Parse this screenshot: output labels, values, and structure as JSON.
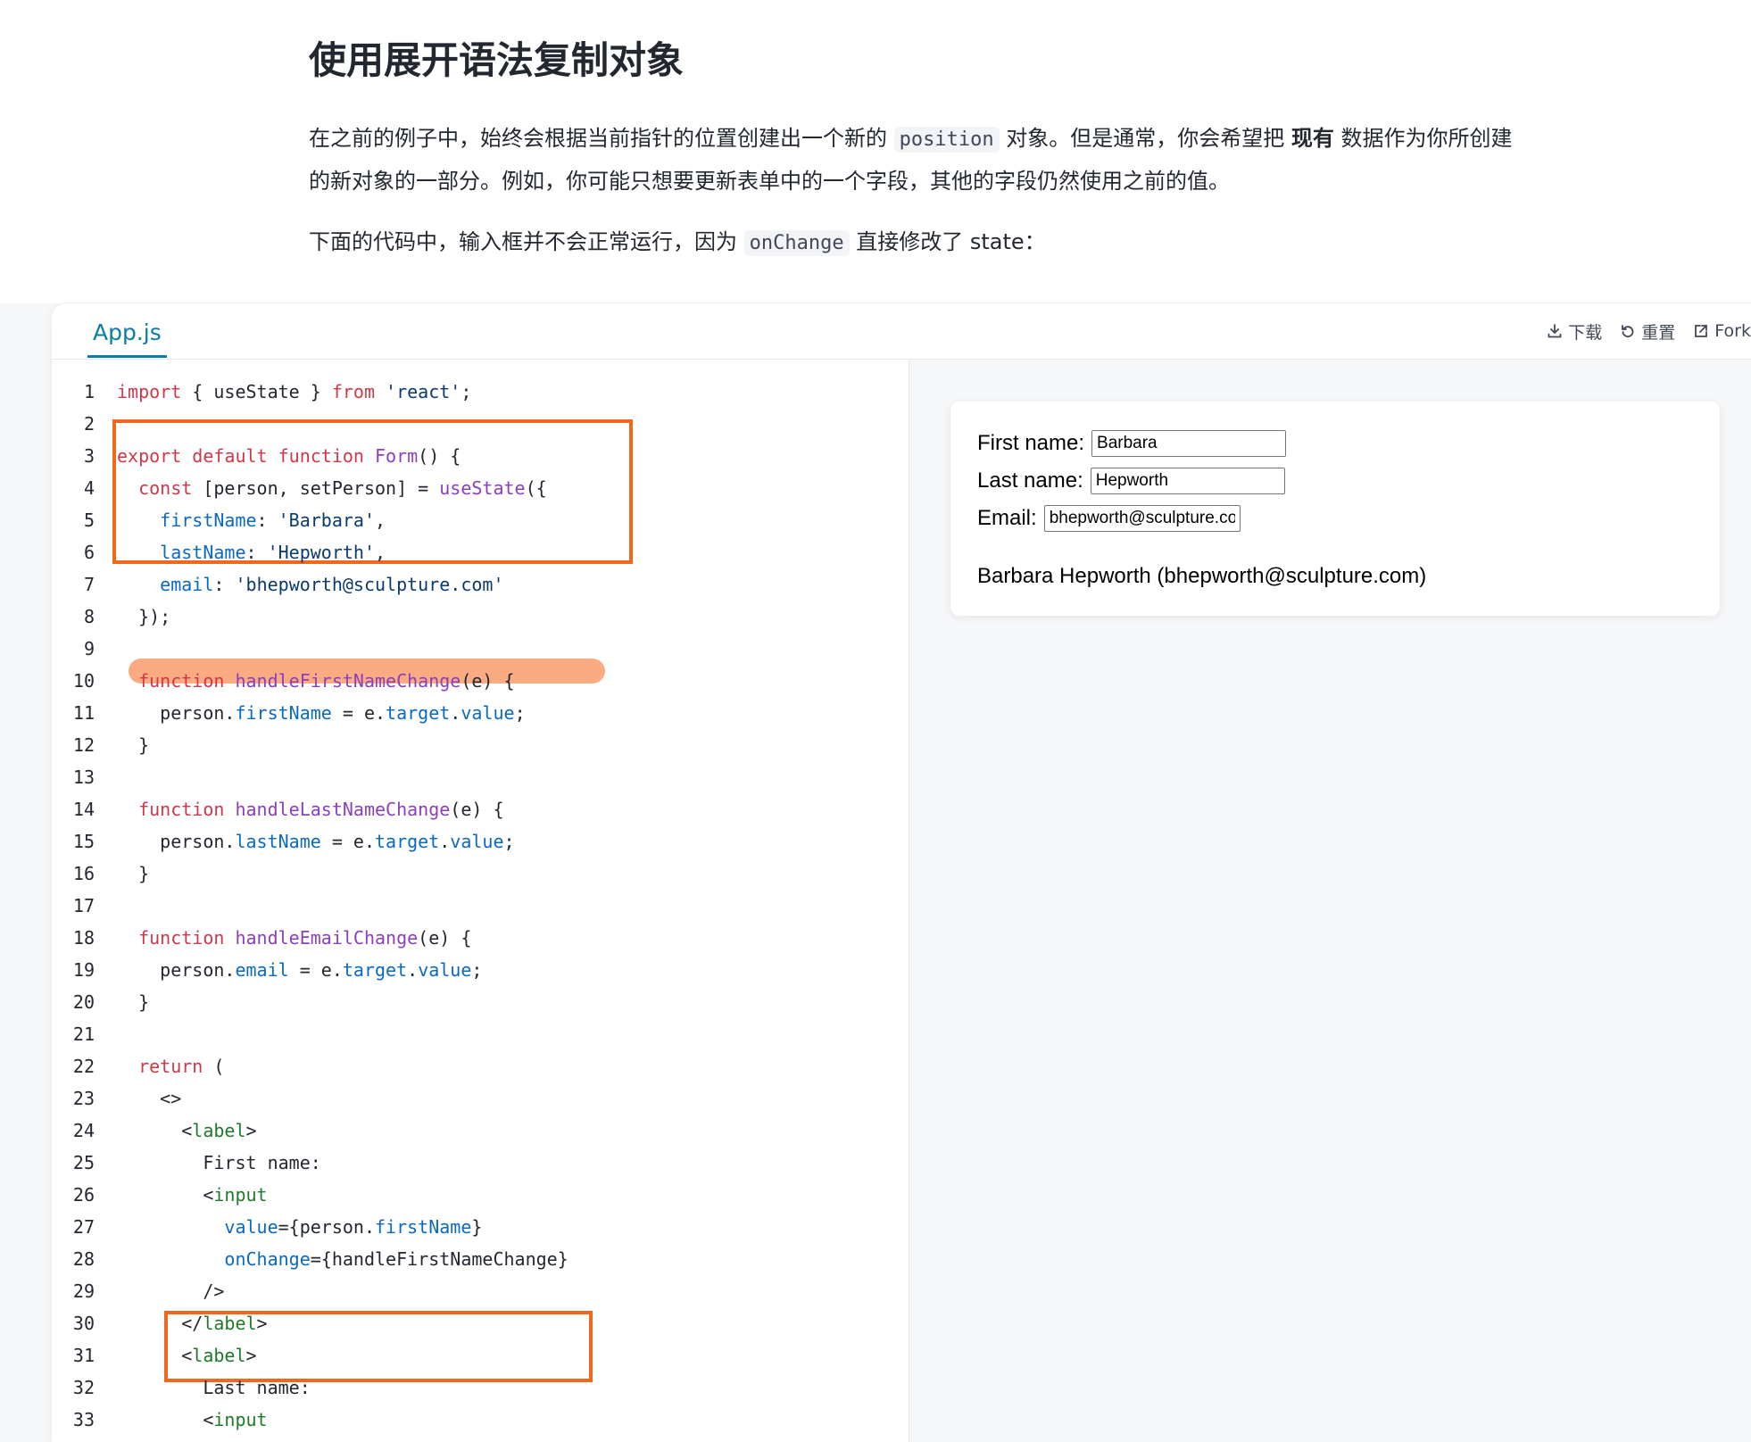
{
  "article": {
    "heading": "使用展开语法复制对象",
    "p1_a": "在之前的例子中，始终会根据当前指针的位置创建出一个新的 ",
    "p1_code": "position",
    "p1_b": " 对象。但是通常，你会希望把 ",
    "p1_bold": "现有",
    "p1_c": " 数据作为你所创建的新对象的一部分。例如，你可能只想要更新表单中的一个字段，其他的字段仍然使用之前的值。",
    "p2_a": "下面的代码中，输入框并不会正常运行，因为 ",
    "p2_code": "onChange",
    "p2_b": " 直接修改了 state："
  },
  "sandbox": {
    "file_tab": "App.js",
    "download_label": "下载",
    "reset_label": "重置",
    "fork_label": "Fork"
  },
  "preview": {
    "first_label": "First name:",
    "first_value": "Barbara",
    "last_label": "Last name:",
    "last_value": "Hepworth",
    "email_label": "Email:",
    "email_value": "bhepworth@sculpture.com",
    "summary": "Barbara Hepworth (bhepworth@sculpture.com)"
  },
  "colors": {
    "accent": "#087ea4",
    "highlight_border": "#f0681e",
    "highlight_fill": "#fbab82",
    "keyword": "#d0384a",
    "function": "#8a3fbd",
    "property": "#0a69c0",
    "string": "#0b3a6e",
    "tag": "#1f7a2a"
  },
  "icons": {
    "download": "download-icon",
    "reset": "reset-icon",
    "fork": "external-link-icon"
  },
  "code": [
    [
      [
        "kw",
        "import"
      ],
      [
        "pl",
        " { useState } "
      ],
      [
        "kw",
        "from"
      ],
      [
        "pl",
        " "
      ],
      [
        "str",
        "'react'"
      ],
      [
        "pl",
        ";"
      ]
    ],
    [],
    [
      [
        "kw",
        "export default function"
      ],
      [
        "pl",
        " "
      ],
      [
        "fn",
        "Form"
      ],
      [
        "pl",
        "() {"
      ]
    ],
    [
      [
        "pl",
        "  "
      ],
      [
        "kw",
        "const"
      ],
      [
        "pl",
        " [person, setPerson] = "
      ],
      [
        "fn",
        "useState"
      ],
      [
        "pl",
        "({"
      ]
    ],
    [
      [
        "pl",
        "    "
      ],
      [
        "prop",
        "firstName"
      ],
      [
        "pl",
        ": "
      ],
      [
        "str",
        "'Barbara'"
      ],
      [
        "pl",
        ","
      ]
    ],
    [
      [
        "pl",
        "    "
      ],
      [
        "prop",
        "lastName"
      ],
      [
        "pl",
        ": "
      ],
      [
        "str",
        "'Hepworth'"
      ],
      [
        "pl",
        ","
      ]
    ],
    [
      [
        "pl",
        "    "
      ],
      [
        "prop",
        "email"
      ],
      [
        "pl",
        ": "
      ],
      [
        "str",
        "'bhepworth@sculpture.com'"
      ]
    ],
    [
      [
        "pl",
        "  });"
      ]
    ],
    [],
    [
      [
        "pl",
        "  "
      ],
      [
        "kw",
        "function"
      ],
      [
        "pl",
        " "
      ],
      [
        "fn",
        "handleFirstNameChange"
      ],
      [
        "pl",
        "(e) {"
      ]
    ],
    [
      [
        "pl",
        "    person."
      ],
      [
        "prop",
        "firstName"
      ],
      [
        "pl",
        " = e."
      ],
      [
        "prop",
        "target"
      ],
      [
        "pl",
        "."
      ],
      [
        "prop",
        "value"
      ],
      [
        "pl",
        ";"
      ]
    ],
    [
      [
        "pl",
        "  }"
      ]
    ],
    [],
    [
      [
        "pl",
        "  "
      ],
      [
        "kw",
        "function"
      ],
      [
        "pl",
        " "
      ],
      [
        "fn",
        "handleLastNameChange"
      ],
      [
        "pl",
        "(e) {"
      ]
    ],
    [
      [
        "pl",
        "    person."
      ],
      [
        "prop",
        "lastName"
      ],
      [
        "pl",
        " = e."
      ],
      [
        "prop",
        "target"
      ],
      [
        "pl",
        "."
      ],
      [
        "prop",
        "value"
      ],
      [
        "pl",
        ";"
      ]
    ],
    [
      [
        "pl",
        "  }"
      ]
    ],
    [],
    [
      [
        "pl",
        "  "
      ],
      [
        "kw",
        "function"
      ],
      [
        "pl",
        " "
      ],
      [
        "fn",
        "handleEmailChange"
      ],
      [
        "pl",
        "(e) {"
      ]
    ],
    [
      [
        "pl",
        "    person."
      ],
      [
        "prop",
        "email"
      ],
      [
        "pl",
        " = e."
      ],
      [
        "prop",
        "target"
      ],
      [
        "pl",
        "."
      ],
      [
        "prop",
        "value"
      ],
      [
        "pl",
        ";"
      ]
    ],
    [
      [
        "pl",
        "  }"
      ]
    ],
    [],
    [
      [
        "pl",
        "  "
      ],
      [
        "kw",
        "return"
      ],
      [
        "pl",
        " ("
      ]
    ],
    [
      [
        "pl",
        "    <>"
      ]
    ],
    [
      [
        "pl",
        "      <"
      ],
      [
        "tag",
        "label"
      ],
      [
        "pl",
        ">"
      ]
    ],
    [
      [
        "pl",
        "        First name:"
      ]
    ],
    [
      [
        "pl",
        "        <"
      ],
      [
        "tag",
        "input"
      ]
    ],
    [
      [
        "pl",
        "          "
      ],
      [
        "prop",
        "value"
      ],
      [
        "pl",
        "={person."
      ],
      [
        "prop",
        "firstName"
      ],
      [
        "pl",
        "}"
      ]
    ],
    [
      [
        "pl",
        "          "
      ],
      [
        "prop",
        "onChange"
      ],
      [
        "pl",
        "={handleFirstNameChange}"
      ]
    ],
    [
      [
        "pl",
        "        />"
      ]
    ],
    [
      [
        "pl",
        "      </"
      ],
      [
        "tag",
        "label"
      ],
      [
        "pl",
        ">"
      ]
    ],
    [
      [
        "pl",
        "      <"
      ],
      [
        "tag",
        "label"
      ],
      [
        "pl",
        ">"
      ]
    ],
    [
      [
        "pl",
        "        Last name:"
      ]
    ],
    [
      [
        "pl",
        "        <"
      ],
      [
        "tag",
        "input"
      ]
    ]
  ]
}
